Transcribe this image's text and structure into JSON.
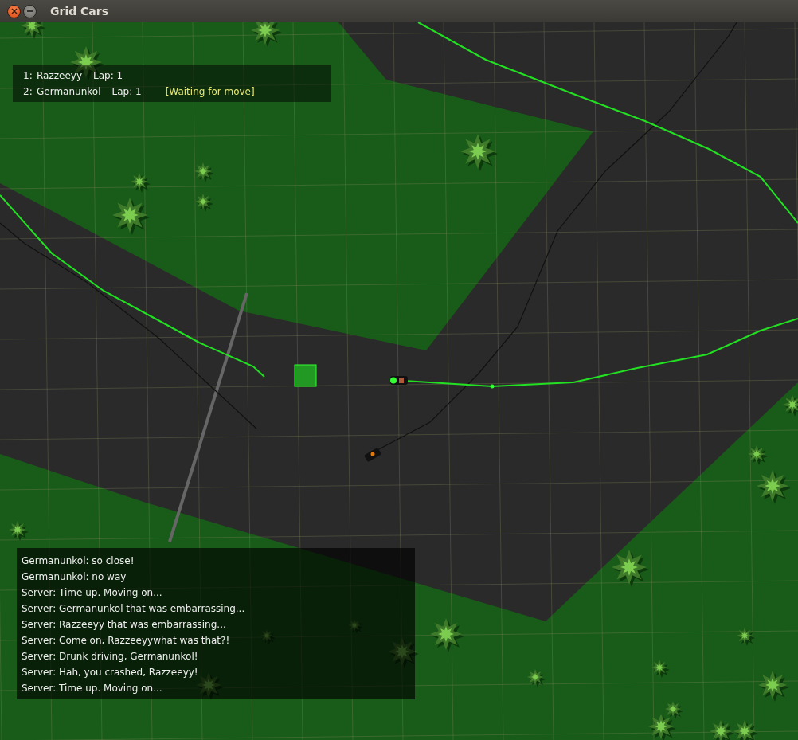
{
  "window": {
    "title": "Grid Cars"
  },
  "scoreboard": [
    {
      "rank": "1:",
      "name": "Razzeeyy",
      "lap": "Lap: 1"
    },
    {
      "rank": "2:",
      "name": "Germanunkol",
      "lap": "Lap: 1",
      "status": "[Waiting for move]"
    }
  ],
  "chat": [
    "Germanunkol: so close!",
    "Germanunkol: no way",
    "Server: Time up. Moving on...",
    "Server: Germanunkol that was embarrassing...",
    "Server: Razzeeyy that was embarrassing...",
    "Server: Come on, Razzeeyywhat was that?!",
    "Server: Drunk driving, Germanunkol!",
    "Server: Hah, you crashed, Razzeeyy!",
    "Server: Time up. Moving on..."
  ]
}
